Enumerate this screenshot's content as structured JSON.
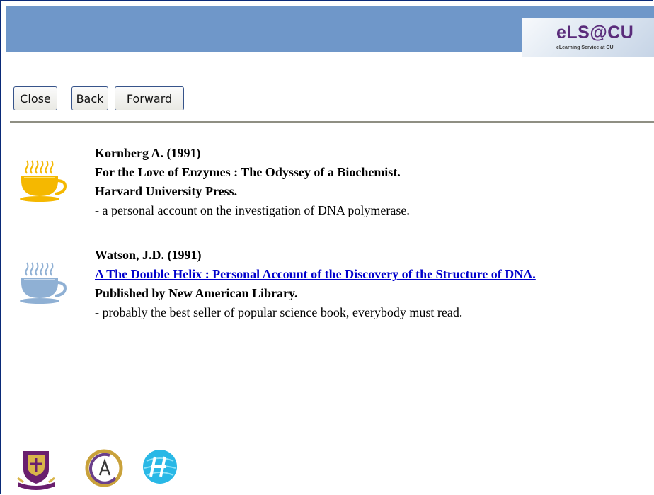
{
  "header": {
    "logo_text": "eLS@CU",
    "logo_subtext": "eLearning Service at CU",
    "bar_color": "#6f97c9"
  },
  "nav": {
    "close_label": "Close",
    "back_label": "Back",
    "forward_label": "Forward"
  },
  "entries": [
    {
      "icon": "coffee-cup-yellow-icon",
      "author": "Kornberg A. (1991)",
      "title": "For the Love of Enzymes : The Odyssey of a Biochemist.",
      "publisher": "Harvard University Press.",
      "note": "- a personal account on the investigation of DNA polymerase.",
      "cup_color": "#f5b800"
    },
    {
      "icon": "coffee-cup-blue-icon",
      "author": "Watson, J.D. (1991)",
      "title": "A The Double Helix : Personal Account of the Discovery of the Structure of DNA.",
      "publisher": "Published by New American Library.",
      "note": "- probably the best seller of popular science book, everybody must read.",
      "cup_color": "#8fb0d4"
    }
  ],
  "footer": {
    "icons": [
      "cuhk-crest-icon",
      "circular-logo-icon",
      "globe-logo-icon"
    ]
  }
}
